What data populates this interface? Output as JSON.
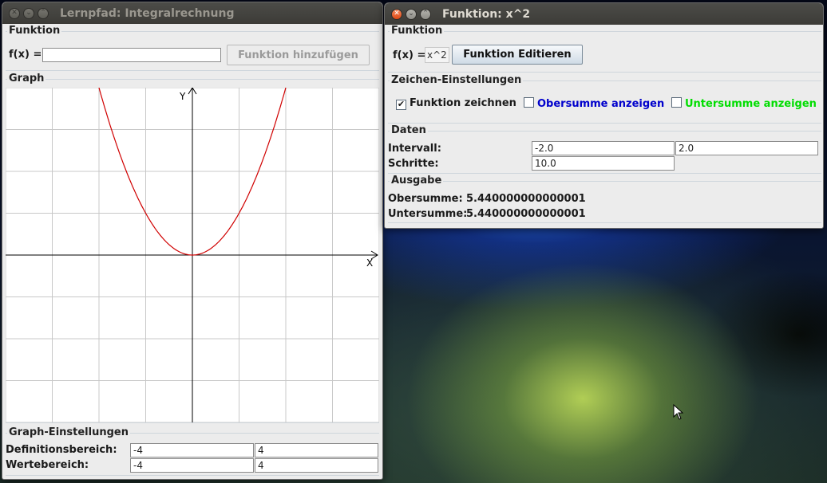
{
  "left_window": {
    "title": "Lernpfad: Integralrechnung",
    "funktion_group": "Funktion",
    "fx_label": "f(x) =",
    "fx_input_value": "",
    "add_button": "Funktion hinzufügen",
    "graph_group": "Graph",
    "axis_x_label": "X",
    "axis_y_label": "Y",
    "curve_color": "#d00000",
    "settings_group": "Graph-Einstellungen",
    "definitionsbereich_label": "Definitionsbereich:",
    "definitionsbereich_min": "-4",
    "definitionsbereich_max": "4",
    "wertebereich_label": "Wertebereich:",
    "wertebereich_min": "-4",
    "wertebereich_max": "4"
  },
  "right_window": {
    "title": "Funktion: x^2",
    "funktion_group": "Funktion",
    "fx_label": "f(x) =",
    "fx_value": "x^2",
    "edit_button": "Funktion Editieren",
    "zeichen_group": "Zeichen-Einstellungen",
    "cb_funktion": "Funktion zeichnen",
    "cb_funktion_checked": true,
    "cb_obersumme": "Obersumme anzeigen",
    "cb_obersumme_color": "#0000cc",
    "cb_untersumme": "Untersumme anzeigen",
    "cb_untersumme_color": "#00dd00",
    "daten_group": "Daten",
    "intervall_label": "Intervall:",
    "intervall_min": "-2.0",
    "intervall_max": "2.0",
    "schritte_label": "Schritte:",
    "schritte_value": "10.0",
    "ausgabe_group": "Ausgabe",
    "obersumme_label": "Obersumme:",
    "obersumme_value": "5.440000000000001",
    "untersumme_label": "Untersumme:",
    "untersumme_value": "5.440000000000001"
  }
}
